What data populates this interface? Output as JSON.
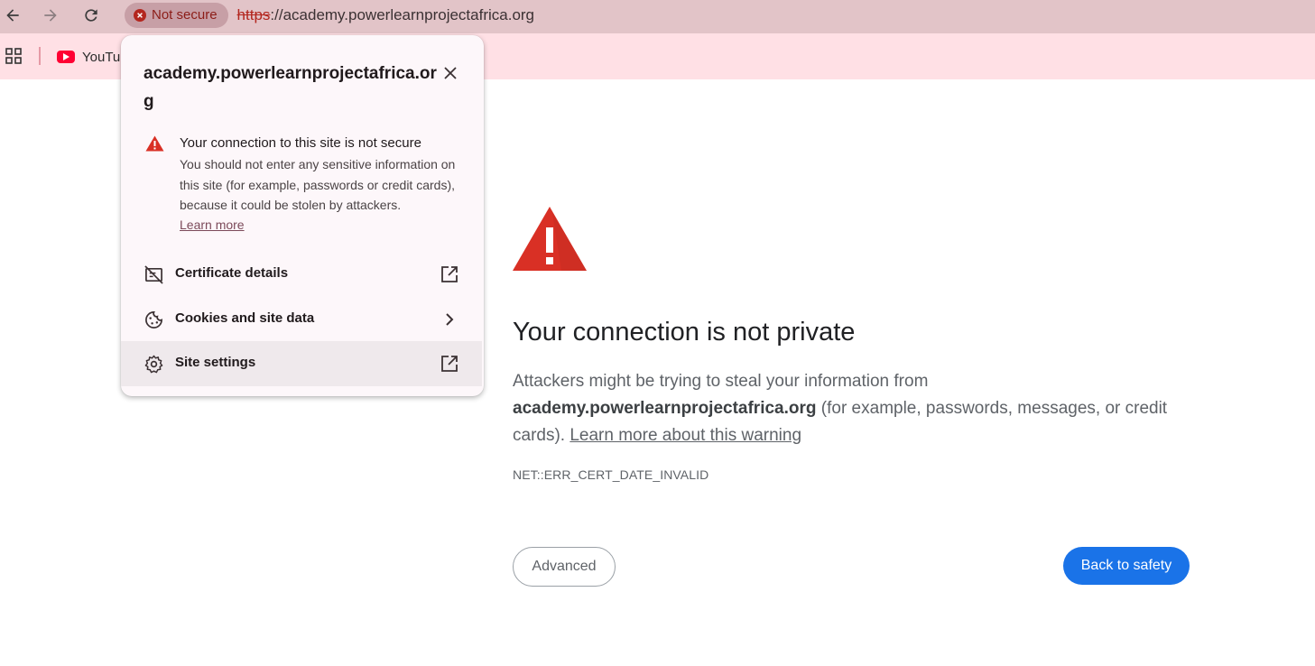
{
  "toolbar": {
    "back_icon": "arrow-back-icon",
    "forward_icon": "arrow-forward-icon",
    "reload_icon": "reload-icon",
    "security_chip": {
      "icon": "error-circle-icon",
      "label": "Not secure"
    },
    "url": {
      "scheme": "https",
      "rest": "://academy.powerlearnprojectafrica.org"
    }
  },
  "bookmarks": {
    "apps_icon": "apps-grid-icon",
    "items": [
      {
        "icon": "youtube-icon",
        "label": "YouTube"
      }
    ]
  },
  "popup": {
    "title": "academy.powerlearnprojectafrica.org",
    "close_icon": "close-icon",
    "security": {
      "icon": "warning-triangle-icon",
      "title": "Your connection to this site is not secure",
      "body": "You should not enter any sensitive information on this site (for example, passwords or credit cards), because it could be stolen by attackers.",
      "learn_more": "Learn more"
    },
    "rows": [
      {
        "icon": "certificate-icon",
        "label": "Certificate details",
        "trailing_icon": "open-in-new-icon"
      },
      {
        "icon": "cookie-icon",
        "label": "Cookies and site data",
        "trailing_icon": "chevron-right-icon"
      },
      {
        "icon": "gear-icon",
        "label": "Site settings",
        "trailing_icon": "open-in-new-icon"
      }
    ]
  },
  "interstitial": {
    "icon": "warning-triangle-icon",
    "title": "Your connection is not private",
    "body_prefix": "Attackers might be trying to steal your information from",
    "body_domain": "academy.powerlearnprojectafrica.org",
    "body_suffix": " (for example, passwords, messages, or credit cards). ",
    "learn_link": "Learn more about this warning",
    "error_code": "NET::ERR_CERT_DATE_INVALID",
    "advanced_button": "Advanced",
    "back_button": "Back to safety"
  },
  "colors": {
    "toolbar_bg": "#e2c4c8",
    "bookmarks_bg": "#ffe0e5",
    "danger": "#d93025",
    "primary_button": "#1a73e8"
  }
}
